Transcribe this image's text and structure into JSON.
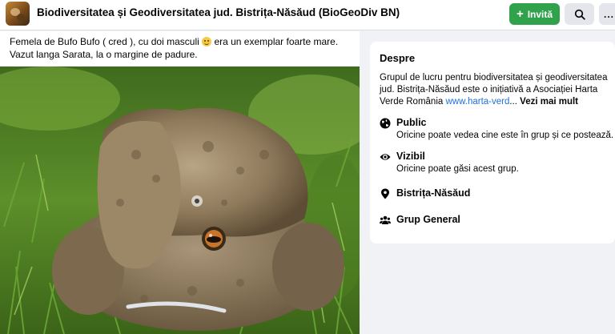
{
  "header": {
    "group_title": "Biodiversitatea și Geodiversitatea jud. Bistrița-Năsăud (BioGeoDiv BN)",
    "invite_label": "Invită",
    "more_label": "..."
  },
  "post": {
    "text_before_emoji": "Femela de Bufo Bufo ( cred ), cu doi masculi ",
    "text_after_emoji": " era un exemplar foarte mare. Vazut langa Sarata, la o margine de padure.",
    "photo_icon": "toad-photo"
  },
  "about": {
    "title": "Despre",
    "description": "Grupul de lucru pentru biodiversitatea și geodiversitatea jud. Bistrița-Năsăud este o inițiativă a Asociației Harta Verde România ",
    "link_text": "www.harta-verd",
    "ellipsis": "...",
    "see_more": "Vezi mai mult",
    "items": [
      {
        "icon": "globe-icon",
        "label": "Public",
        "sub": "Oricine poate vedea cine este în grup și ce postează."
      },
      {
        "icon": "eye-icon",
        "label": "Vizibil",
        "sub": "Oricine poate găsi acest grup."
      },
      {
        "icon": "location-pin-icon",
        "label": "Bistrița-Năsăud",
        "sub": ""
      },
      {
        "icon": "group-icon",
        "label": "Grup General",
        "sub": ""
      }
    ]
  },
  "colors": {
    "invite_green": "#31a24c",
    "link_blue": "#216fdb",
    "page_bg": "#f0f2f5"
  }
}
